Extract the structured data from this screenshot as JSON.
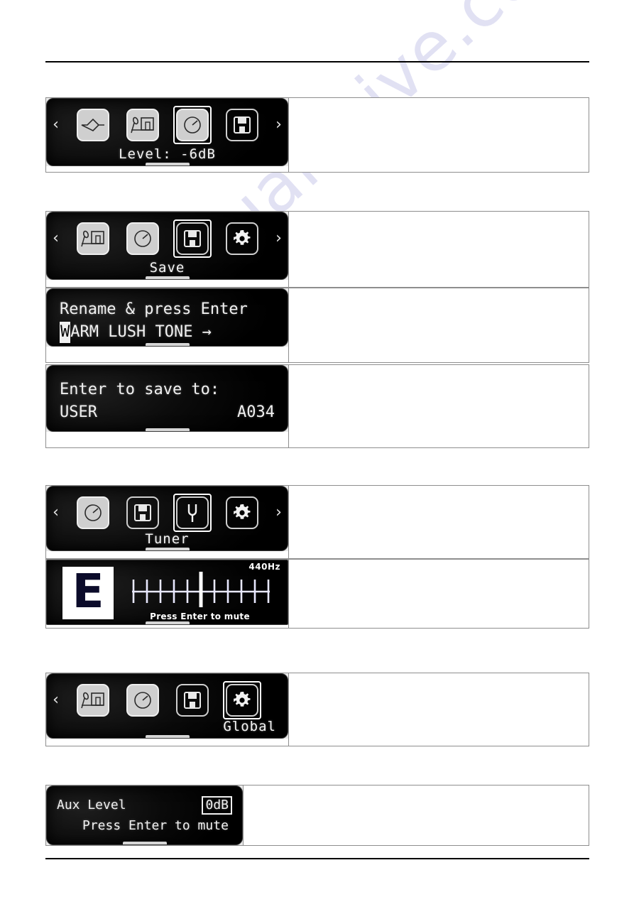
{
  "page": {
    "watermark": "manualshive.com"
  },
  "blocks": [
    {
      "id": "level-menu",
      "type": "menu",
      "left_arrow": "‹",
      "right_arrow": "›",
      "icons": [
        {
          "name": "amp-icon",
          "style": "light",
          "selected": false
        },
        {
          "name": "cab-mic-icon",
          "style": "light",
          "selected": false
        },
        {
          "name": "effects-knob-icon",
          "style": "light",
          "selected": true
        },
        {
          "name": "save-floppy-icon",
          "style": "outline",
          "selected": false
        }
      ],
      "label": "Level:  -6dB",
      "label_align": "center"
    },
    {
      "id": "save-menu",
      "type": "menu",
      "left_arrow": "‹",
      "right_arrow": "›",
      "icons": [
        {
          "name": "cab-mic-icon",
          "style": "light",
          "selected": false
        },
        {
          "name": "effects-knob-icon",
          "style": "light",
          "selected": false
        },
        {
          "name": "save-floppy-icon",
          "style": "outline",
          "selected": true
        },
        {
          "name": "global-gear-icon",
          "style": "outline",
          "selected": false
        }
      ],
      "label": "Save",
      "label_align": "center"
    },
    {
      "id": "rename-screen",
      "type": "text",
      "line1": "Rename & press Enter",
      "line2_cursor": "W",
      "line2_rest": "ARM LUSH TONE →"
    },
    {
      "id": "save-to-screen",
      "type": "text2",
      "line1": "Enter to save to:",
      "line2_left": "USER",
      "line2_right": "A034"
    },
    {
      "id": "tuner-menu",
      "type": "menu",
      "left_arrow": "‹",
      "right_arrow": "›",
      "icons": [
        {
          "name": "effects-knob-icon",
          "style": "light",
          "selected": false
        },
        {
          "name": "save-floppy-icon",
          "style": "outline",
          "selected": false
        },
        {
          "name": "tuning-fork-icon",
          "style": "outline",
          "selected": true
        },
        {
          "name": "global-gear-icon",
          "style": "outline",
          "selected": false
        }
      ],
      "label": "Tuner",
      "label_align": "center"
    },
    {
      "id": "tuner-screen",
      "type": "tuner",
      "note": "E",
      "reference": "440Hz",
      "hint": "Press Enter to mute",
      "ticks": 11,
      "needle_index": 5
    },
    {
      "id": "global-menu",
      "type": "menu",
      "left_arrow": "‹",
      "right_arrow": "",
      "icons": [
        {
          "name": "cab-mic-icon",
          "style": "light",
          "selected": false
        },
        {
          "name": "effects-knob-icon",
          "style": "light",
          "selected": false
        },
        {
          "name": "save-floppy-icon",
          "style": "outline",
          "selected": false
        },
        {
          "name": "global-gear-icon",
          "style": "outline",
          "selected": true
        }
      ],
      "label": "Global",
      "label_align": "right"
    },
    {
      "id": "aux-level-screen",
      "type": "aux",
      "line1_left": "Aux Level",
      "line1_value": "0dB",
      "line2": "Press Enter to mute"
    }
  ]
}
